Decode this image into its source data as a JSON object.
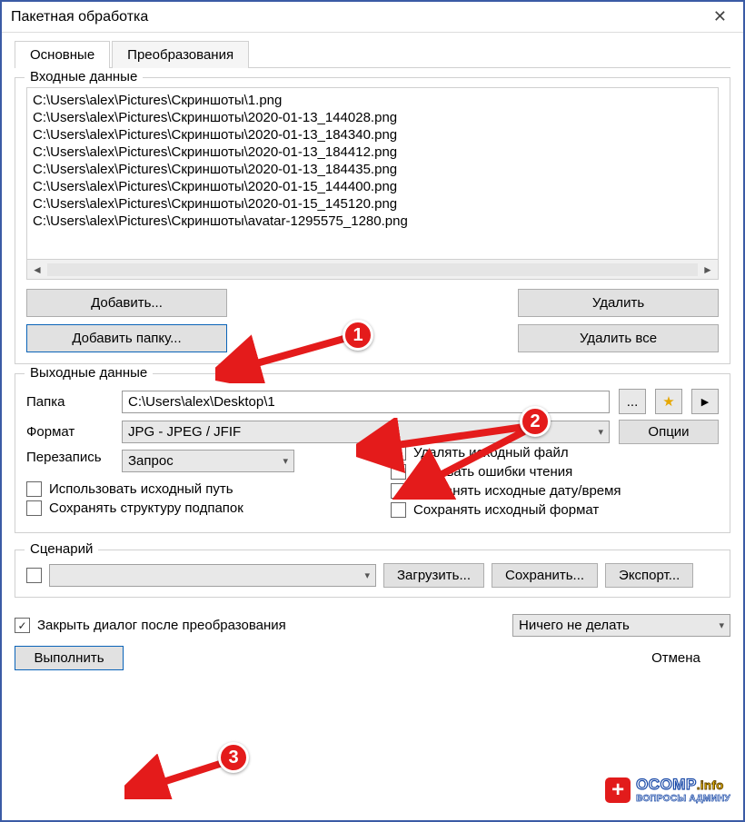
{
  "window": {
    "title": "Пакетная обработка"
  },
  "tabs": {
    "main": "Основные",
    "transforms": "Преобразования"
  },
  "input": {
    "legend": "Входные данные",
    "files": [
      "C:\\Users\\alex\\Pictures\\Скриншоты\\1.png",
      "C:\\Users\\alex\\Pictures\\Скриншоты\\2020-01-13_144028.png",
      "C:\\Users\\alex\\Pictures\\Скриншоты\\2020-01-13_184340.png",
      "C:\\Users\\alex\\Pictures\\Скриншоты\\2020-01-13_184412.png",
      "C:\\Users\\alex\\Pictures\\Скриншоты\\2020-01-13_184435.png",
      "C:\\Users\\alex\\Pictures\\Скриншоты\\2020-01-15_144400.png",
      "C:\\Users\\alex\\Pictures\\Скриншоты\\2020-01-15_145120.png",
      "C:\\Users\\alex\\Pictures\\Скриншоты\\avatar-1295575_1280.png"
    ],
    "buttons": {
      "add": "Добавить...",
      "add_folder": "Добавить папку...",
      "remove": "Удалить",
      "remove_all": "Удалить все"
    }
  },
  "output": {
    "legend": "Выходные данные",
    "folder_label": "Папка",
    "folder_value": "C:\\Users\\alex\\Desktop\\1",
    "browse": "...",
    "format_label": "Формат",
    "format_value": "JPG - JPEG / JFIF",
    "options": "Опции",
    "overwrite_label": "Перезапись",
    "overwrite_value": "Запрос",
    "checks": {
      "use_source_path": "Использовать исходный путь",
      "keep_subfolders": "Сохранять структуру подпапок",
      "delete_source": "Удалять исходный файл",
      "hide_read_errors": "Скрывать ошибки чтения",
      "keep_datetime": "Сохранять исходные дату/время",
      "keep_format": "Сохранять исходный формат"
    }
  },
  "scenario": {
    "legend": "Сценарий",
    "load": "Загрузить...",
    "save": "Сохранить...",
    "export": "Экспорт..."
  },
  "bottom": {
    "close_after": "Закрыть диалог после преобразования",
    "after_action": "Ничего не делать",
    "run": "Выполнить",
    "cancel": "Отмена"
  },
  "watermark": {
    "brand": "OCOMP",
    "suffix": ".info",
    "sub": "ВОПРОСЫ АДМИНУ"
  }
}
